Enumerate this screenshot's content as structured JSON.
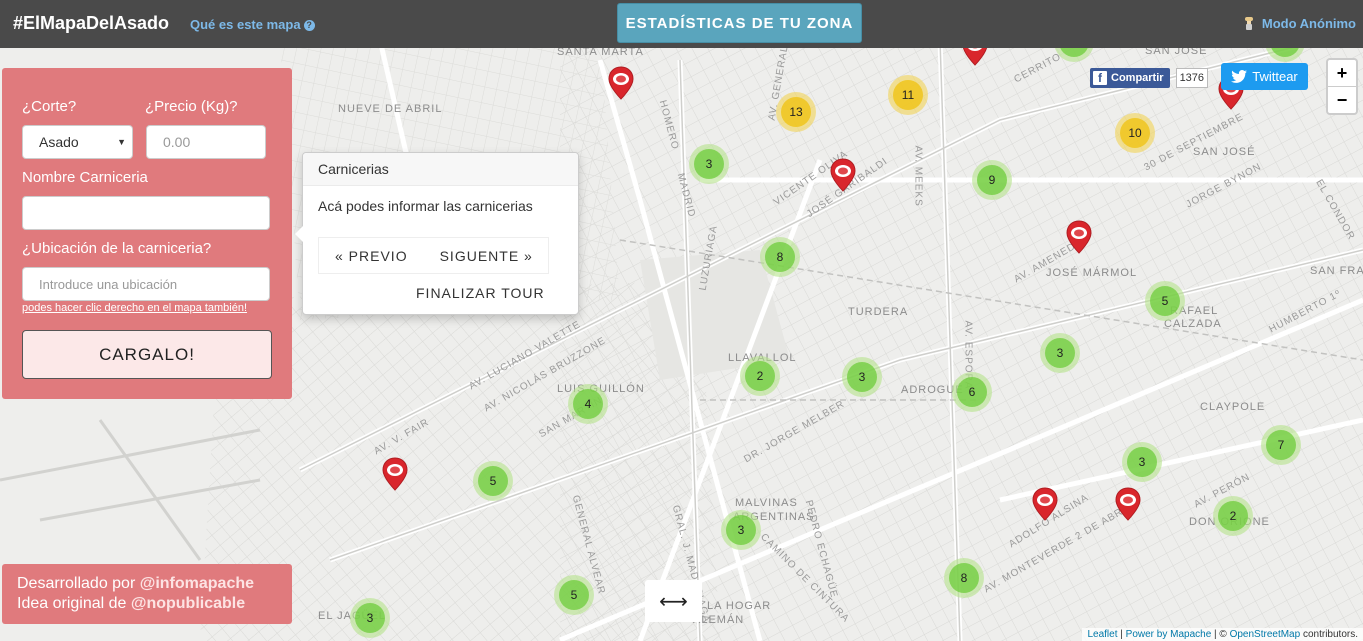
{
  "topbar": {
    "brand": "#ElMapaDelAsado",
    "what_link": "Qué es este mapa",
    "what_icon": "question-circle-icon",
    "stats_button": "ESTADÍSTICAS DE TU ZONA",
    "anon_icon": "chef-icon",
    "anon_label": "Modo Anónimo",
    "bg_color": "#4a4a4a",
    "link_color": "#7db9e8",
    "stats_color": "#5aa5bd"
  },
  "social": {
    "facebook_label": "Compartir",
    "facebook_count": "1376",
    "twitter_label": "Twittear"
  },
  "zoom": {
    "in": "+",
    "out": "−"
  },
  "form": {
    "corte_label": "¿Corte?",
    "corte_value": "Asado",
    "precio_label": "¿Precio (Kg)?",
    "precio_placeholder": "0.00",
    "nombre_label": "Nombre Carniceria",
    "nombre_value": "",
    "ubicacion_label": "¿Ubicación de la carniceria?",
    "ubicacion_placeholder": "Introduce una ubicación",
    "hint": "podes hacer clic derecho en el mapa también!",
    "submit": "CARGALO!",
    "panel_color": "#e07a7d"
  },
  "credits": {
    "line1_prefix": "Desarrollado por ",
    "line1_handle": "@infomapache",
    "line2_prefix": "Idea original de ",
    "line2_handle": "@nopublicable"
  },
  "tour": {
    "title": "Carnicerias",
    "content": "Acá podes informar las carnicerias",
    "prev": "« PREVIO",
    "next": "SIGUENTE »",
    "end": "FINALIZAR TOUR"
  },
  "map": {
    "place_labels": [
      "SANTA MARTA",
      "NUEVE DE ABRIL",
      "SAN JOSE",
      "SAN JOSÉ",
      "TURDERA",
      "LLAVALLOL",
      "ADROGUÉ",
      "LUIS GUILLÓN",
      "JOSÉ MÁRMOL",
      "RAFAEL",
      "CALZADA",
      "CLAYPOLE",
      "MALVINAS",
      "ARGENTINAS",
      "LA HOGAR",
      "ALEMÁN",
      "DON ORIONE",
      "EL JAGÜEL",
      "SAN FRAN"
    ],
    "street_labels": [
      "AV. LUCIANO VALETTE",
      "AV. NICOLÁS BRUZZONE",
      "AV. V. FAIR",
      "DR. JORGE MELBER",
      "AV. ESPORA",
      "AV. MEEKS",
      "AV. GENERAL PAZ",
      "JOSÉ GARIBALDI",
      "VICENTE OLIVA",
      "MADRID",
      "HOMERO",
      "LUZURIAGA",
      "GENERAL ALVEAR",
      "GRAL. J. MADARIAGA",
      "CAMINO DE CINTURA",
      "PEDRO ECHAGÜE",
      "ADOLFO ALSINA",
      "AV. MONTEVERDE 2 DE ABRIL",
      "30 DE SEPTIEMBRE",
      "JORGE BYNON",
      "AV. AMENEDO",
      "HUMBERTO 1º",
      "CERRITO",
      "AV. PERÓN",
      "SAN MARTÍN",
      "EL CONDOR"
    ],
    "clusters": [
      {
        "count": "13",
        "level": "yellow"
      },
      {
        "count": "11",
        "level": "yellow"
      },
      {
        "count": "10",
        "level": "yellow"
      },
      {
        "count": "3",
        "level": "green"
      },
      {
        "count": "9",
        "level": "green"
      },
      {
        "count": "8",
        "level": "green"
      },
      {
        "count": "5",
        "level": "green"
      },
      {
        "count": "3",
        "level": "green"
      },
      {
        "count": "2",
        "level": "green"
      },
      {
        "count": "3",
        "level": "green"
      },
      {
        "count": "6",
        "level": "green"
      },
      {
        "count": "4",
        "level": "green"
      },
      {
        "count": "7",
        "level": "green"
      },
      {
        "count": "3",
        "level": "green"
      },
      {
        "count": "5",
        "level": "green"
      },
      {
        "count": "3",
        "level": "green"
      },
      {
        "count": "2",
        "level": "green"
      },
      {
        "count": "8",
        "level": "green"
      },
      {
        "count": "5",
        "level": "green"
      },
      {
        "count": "3",
        "level": "green"
      }
    ],
    "marker_icon": "meat-pin-icon"
  },
  "resize_icon": "horizontal-resize-icon",
  "attribution": {
    "leaflet": "Leaflet",
    "sep1": " | ",
    "power": "Power by Mapache",
    "sep2": " | © ",
    "osm": "OpenStreetMap",
    "suffix": " contributors."
  }
}
